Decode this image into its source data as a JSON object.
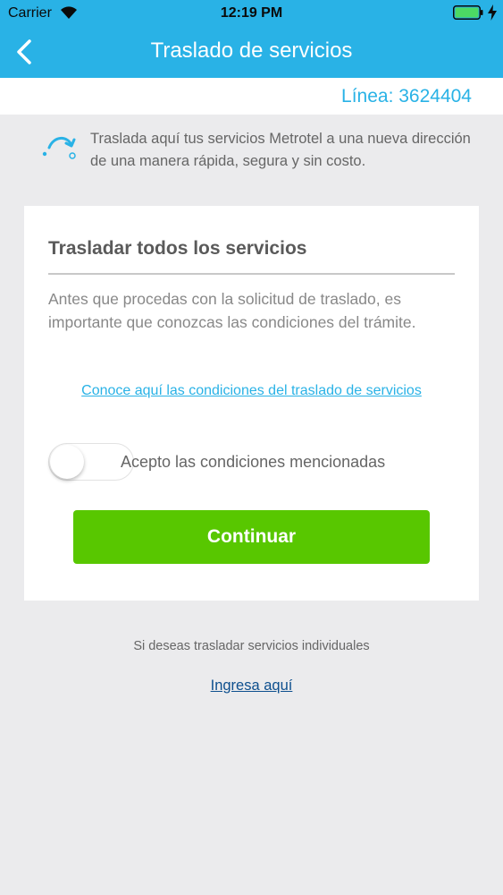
{
  "status_bar": {
    "carrier": "Carrier",
    "time": "12:19 PM",
    "battery_color": "#4cd964"
  },
  "nav": {
    "title": "Traslado de servicios",
    "back_icon": "chevron-left-icon"
  },
  "line": {
    "label": "Línea: 3624404"
  },
  "intro": {
    "icon": "move-arrow-icon",
    "text": "Traslada aquí tus servicios Metrotel a una nueva dirección de una manera rápida, segura y sin costo."
  },
  "card": {
    "title": "Trasladar todos los servicios",
    "description": "Antes que procedas con la solicitud de traslado, es importante que conozcas las condiciones del trámite.",
    "conditions_link": "Conoce aquí las condiciones del traslado de servicios",
    "toggle_on": false,
    "accept_label": "Acepto las condiciones mencionadas",
    "continue_label": "Continuar"
  },
  "footer": {
    "individual_text": "Si deseas trasladar servicios individuales",
    "ingresa_link": "Ingresa aquí"
  },
  "colors": {
    "brand_blue": "#29b2e6",
    "continue_green": "#58c700",
    "link_dark_blue": "#0d4f8e",
    "background": "#ebebed"
  }
}
